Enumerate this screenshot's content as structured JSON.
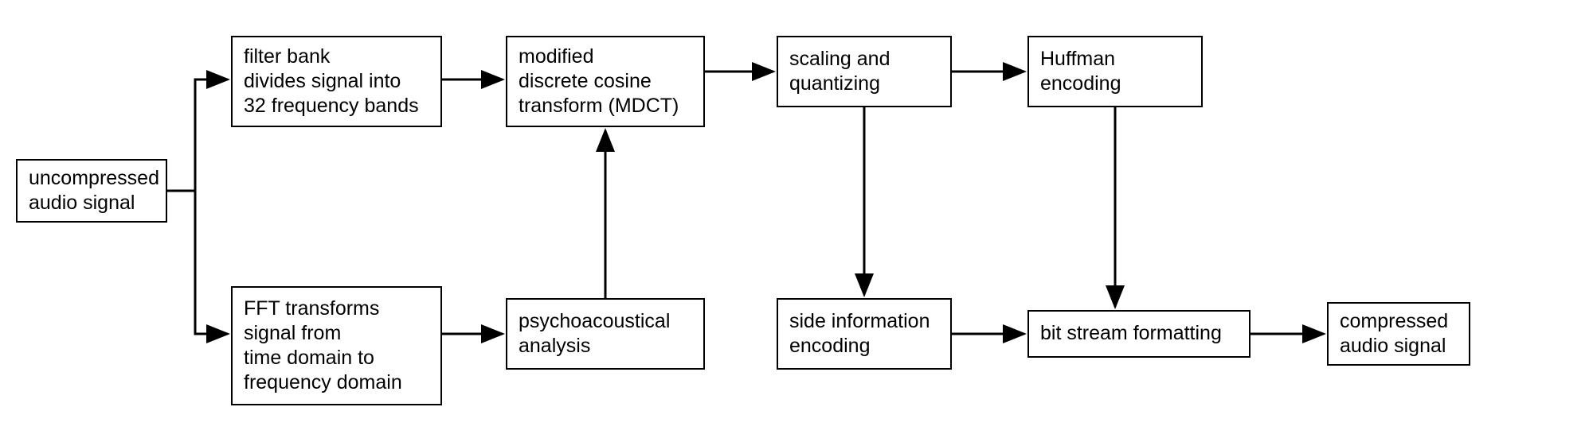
{
  "boxes": {
    "input": "uncompressed\naudio signal",
    "filter_bank": "filter bank\ndivides signal into\n32 frequency bands",
    "fft": "FFT transforms\nsignal from\ntime domain to\nfrequency domain",
    "mdct": "modified\ndiscrete cosine\ntransform (MDCT)",
    "psycho": "psychoacoustical\nanalysis",
    "scaling": "scaling and\nquantizing",
    "side_info": "side information\nencoding",
    "huffman": "Huffman\nencoding",
    "bitstream": "bit stream formatting",
    "output": "compressed\naudio signal"
  }
}
